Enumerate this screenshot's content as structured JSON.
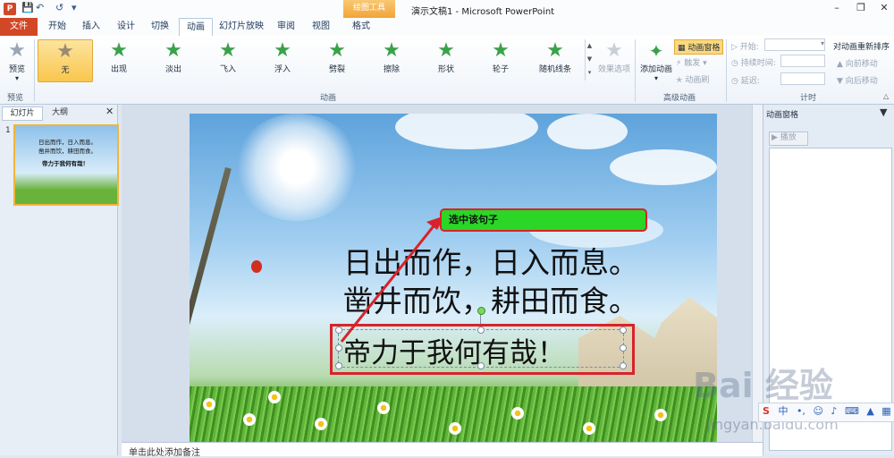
{
  "app": {
    "doc_title": "演示文稿1 - Microsoft PowerPoint",
    "context_tab": "绘图工具",
    "logo_letter": "P"
  },
  "tabs": [
    "文件",
    "开始",
    "插入",
    "设计",
    "切换",
    "动画",
    "幻灯片放映",
    "审阅",
    "视图",
    "格式"
  ],
  "ribbon": {
    "preview": {
      "label": "预览",
      "group": "预览"
    },
    "effects": [
      "无",
      "出现",
      "淡出",
      "飞入",
      "浮入",
      "劈裂",
      "擦除",
      "形状",
      "轮子",
      "随机线条"
    ],
    "effect_options": "效果选项",
    "animation_group": "动画",
    "add_animation": "添加动画",
    "anim_pane_btn": "动画窗格",
    "trigger": "触发",
    "anim_painter": "动画刷",
    "advanced_group": "高级动画",
    "start_label": "开始:",
    "duration_label": "持续时间:",
    "delay_label": "延迟:",
    "timing_group": "计时",
    "reorder_title": "对动画重新排序",
    "move_earlier": "向前移动",
    "move_later": "向后移动"
  },
  "left_pane": {
    "tab_slides": "幻灯片",
    "tab_outline": "大纲",
    "slide_number": "1",
    "thumb_lines": [
      "日出而作，日入而息。",
      "凿井而饮，耕田而食。",
      "帝力于我何有哉！"
    ]
  },
  "slide": {
    "line1": "日出而作，日入而息。",
    "line2": "凿井而饮，耕田而食。",
    "line3": "帝力于我何有哉！",
    "callout": "选中该句子"
  },
  "notes_placeholder": "单击此处添加备注",
  "right_pane": {
    "title": "动画窗格",
    "play": "播放"
  },
  "ime": {
    "s": "S",
    "mode": "中"
  },
  "watermark": {
    "main": "Bai 经验",
    "sub": "jingyan.baidu.com"
  },
  "colors": {
    "file_tab": "#d24726",
    "callout_fill": "#2bd627",
    "highlight": "#d8232a",
    "selected_effect": "#f9c64c"
  }
}
